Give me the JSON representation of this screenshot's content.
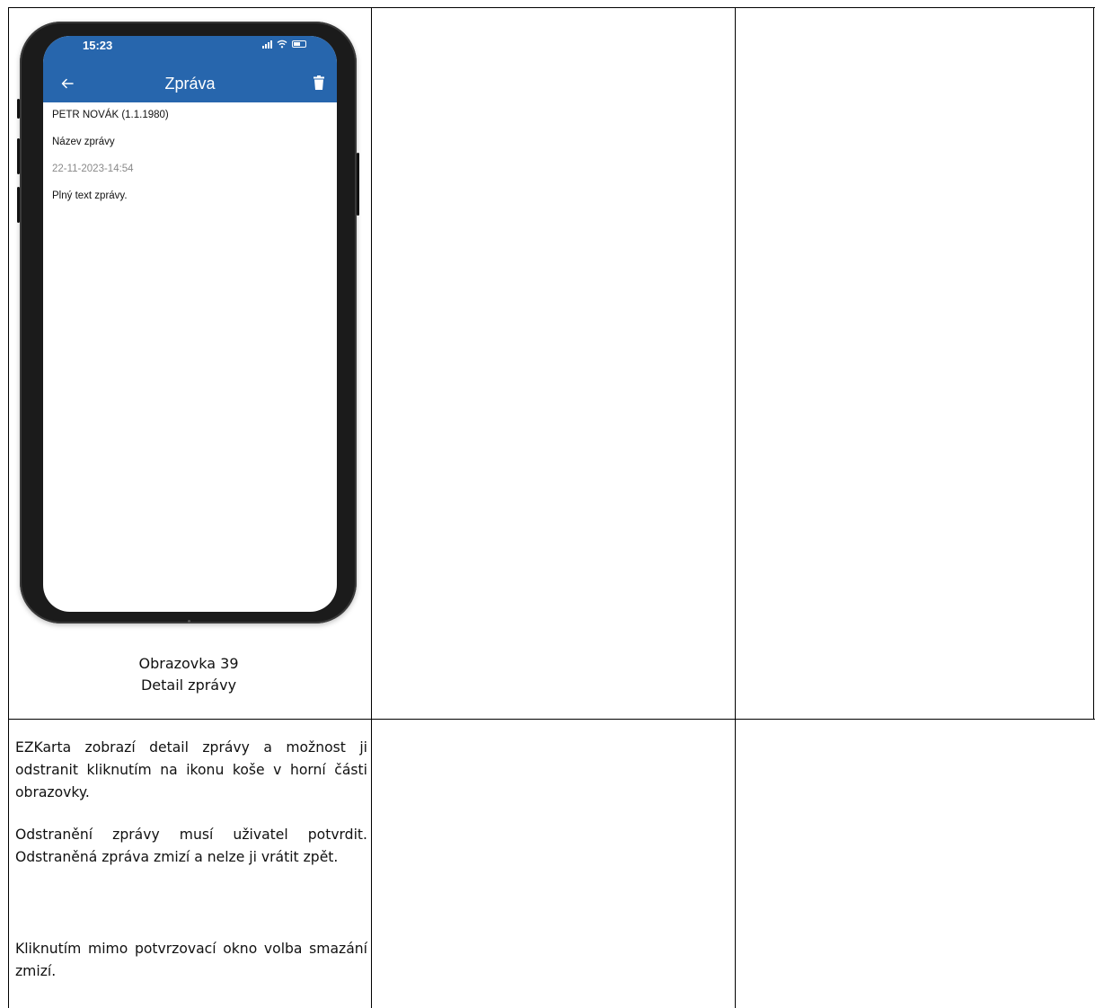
{
  "phone": {
    "status_time": "15:23",
    "header_title": "Zpráva",
    "header_color": "#2766ad",
    "icons": {
      "back": "arrow-left-icon",
      "delete": "trash-icon",
      "signal": "signal-icon",
      "wifi": "wifi-icon",
      "battery": "battery-icon"
    },
    "message": {
      "patient": "PETR NOVÁK (1.1.1980)",
      "title": "Název zprávy",
      "datetime": "22-11-2023-14:54",
      "body": "Plný text zprávy."
    }
  },
  "caption": {
    "line1": "Obrazovka 39",
    "line2": "Detail zprávy"
  },
  "description": [
    "EZKarta zobrazí detail zprávy a možnost ji odstranit kliknutím na ikonu koše v horní části obrazovky.",
    "Odstranění zprávy musí uživatel potvrdit. Odstraněná zpráva zmizí a nelze ji vrátit zpět.",
    "Kliknutím mimo potvrzovací okno volba smazání zmizí."
  ]
}
